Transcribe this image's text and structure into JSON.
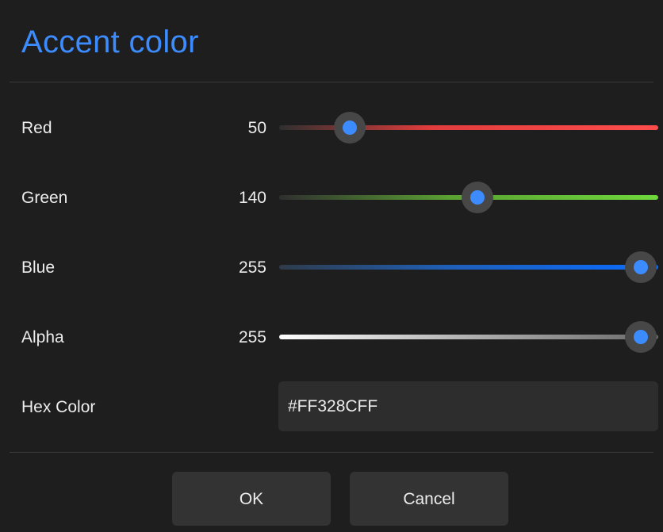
{
  "dialog": {
    "title": "Accent color",
    "accent_color": "#3C8CFF"
  },
  "channels": [
    {
      "label": "Red",
      "value": "50",
      "min": 0,
      "max": 255,
      "track_color": "#FF4D4D"
    },
    {
      "label": "Green",
      "value": "140",
      "min": 0,
      "max": 255,
      "track_color": "#6FD83C"
    },
    {
      "label": "Blue",
      "value": "255",
      "min": 0,
      "max": 255,
      "track_color": "#0A6CFF"
    },
    {
      "label": "Alpha",
      "value": "255",
      "min": 0,
      "max": 255,
      "track_color": "#FFFFFF"
    }
  ],
  "hex": {
    "label": "Hex Color",
    "value": "#FF328CFF"
  },
  "buttons": {
    "ok_label": "OK",
    "cancel_label": "Cancel"
  }
}
